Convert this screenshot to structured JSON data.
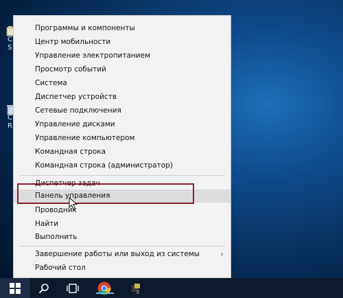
{
  "desktop": {
    "icons": [
      {
        "label": "C\nS",
        "icon": "folder-icon"
      },
      {
        "label": "C\nR",
        "icon": "recycle-bin-icon"
      }
    ]
  },
  "menu": {
    "items": [
      {
        "label": "Программы и компоненты"
      },
      {
        "label": "Центр мобильности"
      },
      {
        "label": "Управление электропитанием"
      },
      {
        "label": "Просмотр событий"
      },
      {
        "label": "Система"
      },
      {
        "label": "Диспетчер устройств"
      },
      {
        "label": "Сетевые подключения"
      },
      {
        "label": "Управление дисками"
      },
      {
        "label": "Управление компьютером"
      },
      {
        "label": "Командная строка"
      },
      {
        "label": "Командная строка (администратор)"
      },
      {
        "label": "Диспетчер задач"
      },
      {
        "label": "Панель управления"
      },
      {
        "label": "Проводник"
      },
      {
        "label": "Найти"
      },
      {
        "label": "Выполнить"
      },
      {
        "label": "Завершение работы или выход из системы"
      },
      {
        "label": "Рабочий стол"
      }
    ],
    "highlighted_index": 12,
    "submenu_indicator": "›"
  },
  "taskbar": {
    "buttons": [
      {
        "name": "start-button",
        "icon": "windows-logo-icon"
      },
      {
        "name": "search-button",
        "icon": "search-icon"
      },
      {
        "name": "task-view-button",
        "icon": "task-view-icon"
      },
      {
        "name": "chrome-button",
        "icon": "chrome-icon"
      },
      {
        "name": "app-button",
        "icon": "app-icon"
      }
    ]
  },
  "colors": {
    "highlight_border": "#8b1f2b",
    "menu_bg": "#f2f2f2",
    "hover_bg": "#dcdcdc",
    "taskbar_bg": "#0c1a2b"
  }
}
